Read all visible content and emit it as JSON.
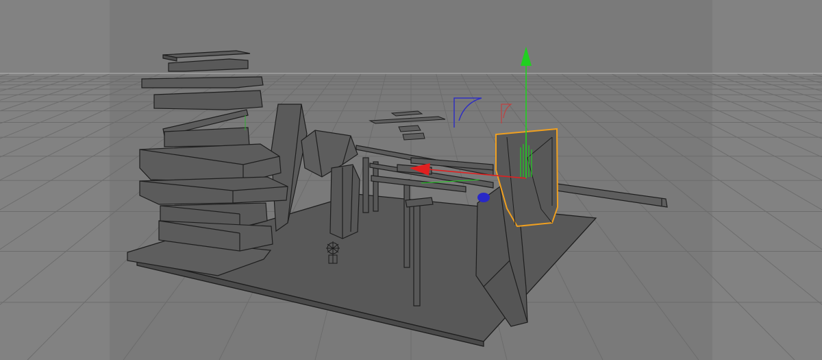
{
  "viewport": {
    "background": "#7a7a7a",
    "safe_frame_shade": "#828282",
    "grid_line_color": "#6c6c6c",
    "horizon_color": "#b4b4b4",
    "mesh_face_color": "#5c5c5c",
    "mesh_edge_color": "#1e1e1e",
    "selection_outline_color": "#f0a020"
  },
  "gizmo": {
    "x_axis_color": "#e02020",
    "y_axis_color": "#20d020",
    "z_axis_color": "#2828c8"
  }
}
